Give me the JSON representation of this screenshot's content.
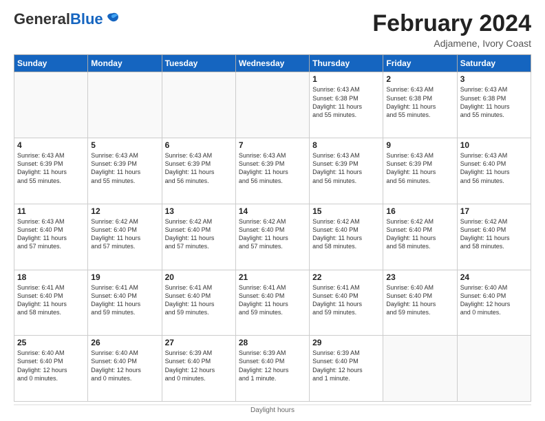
{
  "header": {
    "logo_general": "General",
    "logo_blue": "Blue",
    "title": "February 2024",
    "location": "Adjamene, Ivory Coast"
  },
  "calendar": {
    "days_of_week": [
      "Sunday",
      "Monday",
      "Tuesday",
      "Wednesday",
      "Thursday",
      "Friday",
      "Saturday"
    ],
    "weeks": [
      [
        {
          "day": "",
          "info": "",
          "empty": true
        },
        {
          "day": "",
          "info": "",
          "empty": true
        },
        {
          "day": "",
          "info": "",
          "empty": true
        },
        {
          "day": "",
          "info": "",
          "empty": true
        },
        {
          "day": "1",
          "info": "Sunrise: 6:43 AM\nSunset: 6:38 PM\nDaylight: 11 hours\nand 55 minutes."
        },
        {
          "day": "2",
          "info": "Sunrise: 6:43 AM\nSunset: 6:38 PM\nDaylight: 11 hours\nand 55 minutes."
        },
        {
          "day": "3",
          "info": "Sunrise: 6:43 AM\nSunset: 6:38 PM\nDaylight: 11 hours\nand 55 minutes."
        }
      ],
      [
        {
          "day": "4",
          "info": "Sunrise: 6:43 AM\nSunset: 6:39 PM\nDaylight: 11 hours\nand 55 minutes."
        },
        {
          "day": "5",
          "info": "Sunrise: 6:43 AM\nSunset: 6:39 PM\nDaylight: 11 hours\nand 55 minutes."
        },
        {
          "day": "6",
          "info": "Sunrise: 6:43 AM\nSunset: 6:39 PM\nDaylight: 11 hours\nand 56 minutes."
        },
        {
          "day": "7",
          "info": "Sunrise: 6:43 AM\nSunset: 6:39 PM\nDaylight: 11 hours\nand 56 minutes."
        },
        {
          "day": "8",
          "info": "Sunrise: 6:43 AM\nSunset: 6:39 PM\nDaylight: 11 hours\nand 56 minutes."
        },
        {
          "day": "9",
          "info": "Sunrise: 6:43 AM\nSunset: 6:39 PM\nDaylight: 11 hours\nand 56 minutes."
        },
        {
          "day": "10",
          "info": "Sunrise: 6:43 AM\nSunset: 6:40 PM\nDaylight: 11 hours\nand 56 minutes."
        }
      ],
      [
        {
          "day": "11",
          "info": "Sunrise: 6:43 AM\nSunset: 6:40 PM\nDaylight: 11 hours\nand 57 minutes."
        },
        {
          "day": "12",
          "info": "Sunrise: 6:42 AM\nSunset: 6:40 PM\nDaylight: 11 hours\nand 57 minutes."
        },
        {
          "day": "13",
          "info": "Sunrise: 6:42 AM\nSunset: 6:40 PM\nDaylight: 11 hours\nand 57 minutes."
        },
        {
          "day": "14",
          "info": "Sunrise: 6:42 AM\nSunset: 6:40 PM\nDaylight: 11 hours\nand 57 minutes."
        },
        {
          "day": "15",
          "info": "Sunrise: 6:42 AM\nSunset: 6:40 PM\nDaylight: 11 hours\nand 58 minutes."
        },
        {
          "day": "16",
          "info": "Sunrise: 6:42 AM\nSunset: 6:40 PM\nDaylight: 11 hours\nand 58 minutes."
        },
        {
          "day": "17",
          "info": "Sunrise: 6:42 AM\nSunset: 6:40 PM\nDaylight: 11 hours\nand 58 minutes."
        }
      ],
      [
        {
          "day": "18",
          "info": "Sunrise: 6:41 AM\nSunset: 6:40 PM\nDaylight: 11 hours\nand 58 minutes."
        },
        {
          "day": "19",
          "info": "Sunrise: 6:41 AM\nSunset: 6:40 PM\nDaylight: 11 hours\nand 59 minutes."
        },
        {
          "day": "20",
          "info": "Sunrise: 6:41 AM\nSunset: 6:40 PM\nDaylight: 11 hours\nand 59 minutes."
        },
        {
          "day": "21",
          "info": "Sunrise: 6:41 AM\nSunset: 6:40 PM\nDaylight: 11 hours\nand 59 minutes."
        },
        {
          "day": "22",
          "info": "Sunrise: 6:41 AM\nSunset: 6:40 PM\nDaylight: 11 hours\nand 59 minutes."
        },
        {
          "day": "23",
          "info": "Sunrise: 6:40 AM\nSunset: 6:40 PM\nDaylight: 11 hours\nand 59 minutes."
        },
        {
          "day": "24",
          "info": "Sunrise: 6:40 AM\nSunset: 6:40 PM\nDaylight: 12 hours\nand 0 minutes."
        }
      ],
      [
        {
          "day": "25",
          "info": "Sunrise: 6:40 AM\nSunset: 6:40 PM\nDaylight: 12 hours\nand 0 minutes."
        },
        {
          "day": "26",
          "info": "Sunrise: 6:40 AM\nSunset: 6:40 PM\nDaylight: 12 hours\nand 0 minutes."
        },
        {
          "day": "27",
          "info": "Sunrise: 6:39 AM\nSunset: 6:40 PM\nDaylight: 12 hours\nand 0 minutes."
        },
        {
          "day": "28",
          "info": "Sunrise: 6:39 AM\nSunset: 6:40 PM\nDaylight: 12 hours\nand 1 minute."
        },
        {
          "day": "29",
          "info": "Sunrise: 6:39 AM\nSunset: 6:40 PM\nDaylight: 12 hours\nand 1 minute."
        },
        {
          "day": "",
          "info": "",
          "empty": true
        },
        {
          "day": "",
          "info": "",
          "empty": true
        }
      ]
    ]
  },
  "footer": {
    "text": "Daylight hours"
  }
}
